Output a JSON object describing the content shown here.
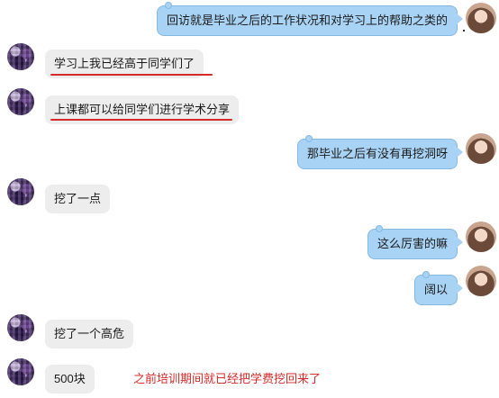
{
  "messages": [
    {
      "side": "self",
      "text": "回访就是毕业之后的工作状况和对学习上的帮助之类的"
    },
    {
      "side": "other",
      "text": "学习上我已经高于同学们了"
    },
    {
      "side": "other",
      "text": "上课都可以给同学们进行学术分享"
    },
    {
      "side": "self",
      "text": "那毕业之后有没有再挖洞呀"
    },
    {
      "side": "other",
      "text": "挖了一点"
    },
    {
      "side": "self",
      "text": "这么厉害的嘛"
    },
    {
      "side": "self",
      "text": "阔以"
    },
    {
      "side": "other",
      "text": "挖了一个高危"
    },
    {
      "side": "other",
      "text": "500块"
    }
  ],
  "annotation": "之前培训期间就已经把学费挖回来了",
  "colors": {
    "self_bubble": "#a9d3f5",
    "other_bubble": "#ededed",
    "highlight": "#d42a2a"
  }
}
